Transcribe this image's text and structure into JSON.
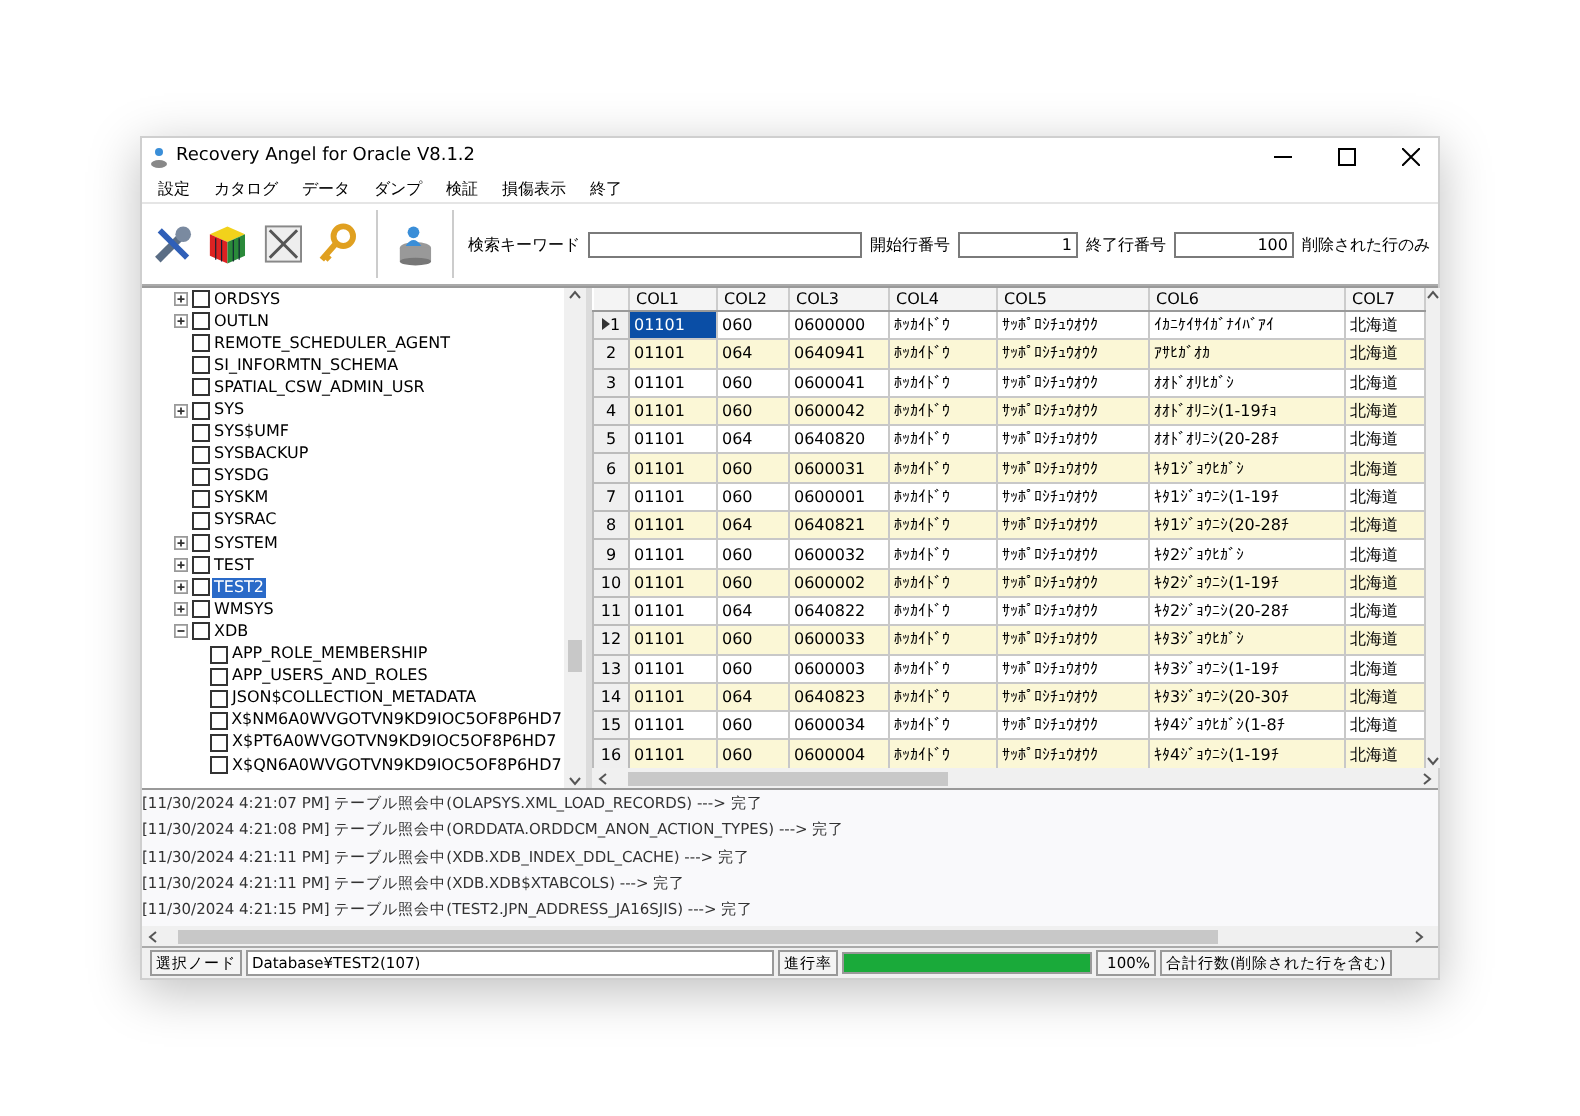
{
  "window": {
    "title": "Recovery Angel for Oracle V8.1.2"
  },
  "menu": [
    "設定",
    "カタログ",
    "データ",
    "ダンプ",
    "検証",
    "損傷表示",
    "終了"
  ],
  "toolbar": {
    "keyword_label": "検索キーワード",
    "start_label": "開始行番号",
    "start_value": "1",
    "end_label": "終了行番号",
    "end_value": "100",
    "deleted_only_label": "削除された行のみ"
  },
  "tree": [
    {
      "label": "ORDSYS",
      "kind": "collapsed",
      "checked": false,
      "selected": false
    },
    {
      "label": "OUTLN",
      "kind": "collapsed",
      "checked": false,
      "selected": false
    },
    {
      "label": "REMOTE_SCHEDULER_AGENT",
      "kind": "leaf",
      "checked": false,
      "selected": false
    },
    {
      "label": "SI_INFORMTN_SCHEMA",
      "kind": "leaf",
      "checked": false,
      "selected": false
    },
    {
      "label": "SPATIAL_CSW_ADMIN_USR",
      "kind": "leaf",
      "checked": false,
      "selected": false
    },
    {
      "label": "SYS",
      "kind": "collapsed",
      "checked": false,
      "selected": false
    },
    {
      "label": "SYS$UMF",
      "kind": "leaf",
      "checked": false,
      "selected": false
    },
    {
      "label": "SYSBACKUP",
      "kind": "leaf",
      "checked": false,
      "selected": false
    },
    {
      "label": "SYSDG",
      "kind": "leaf",
      "checked": false,
      "selected": false
    },
    {
      "label": "SYSKM",
      "kind": "leaf",
      "checked": false,
      "selected": false
    },
    {
      "label": "SYSRAC",
      "kind": "leaf",
      "checked": false,
      "selected": false
    },
    {
      "label": "SYSTEM",
      "kind": "collapsed",
      "checked": false,
      "selected": false
    },
    {
      "label": "TEST",
      "kind": "collapsed",
      "checked": false,
      "selected": false
    },
    {
      "label": "TEST2",
      "kind": "collapsed",
      "checked": false,
      "selected": true
    },
    {
      "label": "WMSYS",
      "kind": "collapsed",
      "checked": false,
      "selected": false
    },
    {
      "label": "XDB",
      "kind": "expanded",
      "checked": false,
      "selected": false,
      "children": [
        {
          "label": "APP_ROLE_MEMBERSHIP",
          "kind": "leaf",
          "checked": false,
          "selected": false
        },
        {
          "label": "APP_USERS_AND_ROLES",
          "kind": "leaf",
          "checked": false,
          "selected": false
        },
        {
          "label": "JSON$COLLECTION_METADATA",
          "kind": "leaf",
          "checked": false,
          "selected": false
        },
        {
          "label": "X$NM6A0WVGOTVN9KD9IOC5OF8P6HD7",
          "kind": "leaf",
          "checked": false,
          "selected": false
        },
        {
          "label": "X$PT6A0WVGOTVN9KD9IOC5OF8P6HD7",
          "kind": "leaf",
          "checked": false,
          "selected": false
        },
        {
          "label": "X$QN6A0WVGOTVN9KD9IOC5OF8P6HD7",
          "kind": "leaf",
          "checked": false,
          "selected": false
        }
      ]
    }
  ],
  "grid": {
    "columns": [
      {
        "label": "COL1",
        "selected": true
      },
      {
        "label": "COL2",
        "selected": false
      },
      {
        "label": "COL3",
        "selected": false
      },
      {
        "label": "COL4",
        "selected": false
      },
      {
        "label": "COL5",
        "selected": false
      },
      {
        "label": "COL6",
        "selected": false
      },
      {
        "label": "COL7",
        "selected": false
      }
    ],
    "rows": [
      {
        "number": "1",
        "current": true,
        "cells": [
          "01101",
          "060",
          "0600000",
          "ﾎｯｶｲﾄﾞｳ",
          "ｻｯﾎﾟﾛｼﾁｭｳｵｳｸ",
          "ｲｶﾆｹｲｻｲｶﾞﾅｲﾊﾞｱｲ",
          "北海道"
        ]
      },
      {
        "number": "2",
        "current": false,
        "cells": [
          "01101",
          "064",
          "0640941",
          "ﾎｯｶｲﾄﾞｳ",
          "ｻｯﾎﾟﾛｼﾁｭｳｵｳｸ",
          "ｱｻﾋｶﾞｵｶ",
          "北海道"
        ]
      },
      {
        "number": "3",
        "current": false,
        "cells": [
          "01101",
          "060",
          "0600041",
          "ﾎｯｶｲﾄﾞｳ",
          "ｻｯﾎﾟﾛｼﾁｭｳｵｳｸ",
          "ｵｵﾄﾞｵﾘﾋｶﾞｼ",
          "北海道"
        ]
      },
      {
        "number": "4",
        "current": false,
        "cells": [
          "01101",
          "060",
          "0600042",
          "ﾎｯｶｲﾄﾞｳ",
          "ｻｯﾎﾟﾛｼﾁｭｳｵｳｸ",
          "ｵｵﾄﾞｵﾘﾆｼ(1-19ﾁｮ",
          "北海道"
        ]
      },
      {
        "number": "5",
        "current": false,
        "cells": [
          "01101",
          "064",
          "0640820",
          "ﾎｯｶｲﾄﾞｳ",
          "ｻｯﾎﾟﾛｼﾁｭｳｵｳｸ",
          "ｵｵﾄﾞｵﾘﾆｼ(20-28ﾁ",
          "北海道"
        ]
      },
      {
        "number": "6",
        "current": false,
        "cells": [
          "01101",
          "060",
          "0600031",
          "ﾎｯｶｲﾄﾞｳ",
          "ｻｯﾎﾟﾛｼﾁｭｳｵｳｸ",
          "ｷﾀ1ｼﾞｮｳﾋｶﾞｼ",
          "北海道"
        ]
      },
      {
        "number": "7",
        "current": false,
        "cells": [
          "01101",
          "060",
          "0600001",
          "ﾎｯｶｲﾄﾞｳ",
          "ｻｯﾎﾟﾛｼﾁｭｳｵｳｸ",
          "ｷﾀ1ｼﾞｮｳﾆｼ(1-19ﾁ",
          "北海道"
        ]
      },
      {
        "number": "8",
        "current": false,
        "cells": [
          "01101",
          "064",
          "0640821",
          "ﾎｯｶｲﾄﾞｳ",
          "ｻｯﾎﾟﾛｼﾁｭｳｵｳｸ",
          "ｷﾀ1ｼﾞｮｳﾆｼ(20-28ﾁ",
          "北海道"
        ]
      },
      {
        "number": "9",
        "current": false,
        "cells": [
          "01101",
          "060",
          "0600032",
          "ﾎｯｶｲﾄﾞｳ",
          "ｻｯﾎﾟﾛｼﾁｭｳｵｳｸ",
          "ｷﾀ2ｼﾞｮｳﾋｶﾞｼ",
          "北海道"
        ]
      },
      {
        "number": "10",
        "current": false,
        "cells": [
          "01101",
          "060",
          "0600002",
          "ﾎｯｶｲﾄﾞｳ",
          "ｻｯﾎﾟﾛｼﾁｭｳｵｳｸ",
          "ｷﾀ2ｼﾞｮｳﾆｼ(1-19ﾁ",
          "北海道"
        ]
      },
      {
        "number": "11",
        "current": false,
        "cells": [
          "01101",
          "064",
          "0640822",
          "ﾎｯｶｲﾄﾞｳ",
          "ｻｯﾎﾟﾛｼﾁｭｳｵｳｸ",
          "ｷﾀ2ｼﾞｮｳﾆｼ(20-28ﾁ",
          "北海道"
        ]
      },
      {
        "number": "12",
        "current": false,
        "cells": [
          "01101",
          "060",
          "0600033",
          "ﾎｯｶｲﾄﾞｳ",
          "ｻｯﾎﾟﾛｼﾁｭｳｵｳｸ",
          "ｷﾀ3ｼﾞｮｳﾋｶﾞｼ",
          "北海道"
        ]
      },
      {
        "number": "13",
        "current": false,
        "cells": [
          "01101",
          "060",
          "0600003",
          "ﾎｯｶｲﾄﾞｳ",
          "ｻｯﾎﾟﾛｼﾁｭｳｵｳｸ",
          "ｷﾀ3ｼﾞｮｳﾆｼ(1-19ﾁ",
          "北海道"
        ]
      },
      {
        "number": "14",
        "current": false,
        "cells": [
          "01101",
          "064",
          "0640823",
          "ﾎｯｶｲﾄﾞｳ",
          "ｻｯﾎﾟﾛｼﾁｭｳｵｳｸ",
          "ｷﾀ3ｼﾞｮｳﾆｼ(20-30ﾁ",
          "北海道"
        ]
      },
      {
        "number": "15",
        "current": false,
        "cells": [
          "01101",
          "060",
          "0600034",
          "ﾎｯｶｲﾄﾞｳ",
          "ｻｯﾎﾟﾛｼﾁｭｳｵｳｸ",
          "ｷﾀ4ｼﾞｮｳﾋｶﾞｼ(1-8ﾁ",
          "北海道"
        ]
      },
      {
        "number": "16",
        "current": false,
        "cells": [
          "01101",
          "060",
          "0600004",
          "ﾎｯｶｲﾄﾞｳ",
          "ｻｯﾎﾟﾛｼﾁｭｳｵｳｸ",
          "ｷﾀ4ｼﾞｮｳﾆｼ(1-19ﾁ",
          "北海道"
        ]
      }
    ]
  },
  "log": [
    "[11/30/2024 4:21:07 PM] テーブル照会中(OLAPSYS.XML_LOAD_RECORDS) ---> 完了",
    "[11/30/2024 4:21:08 PM] テーブル照会中(ORDDATA.ORDDCM_ANON_ACTION_TYPES) ---> 完了",
    "[11/30/2024 4:21:11 PM] テーブル照会中(XDB.XDB_INDEX_DDL_CACHE) ---> 完了",
    "[11/30/2024 4:21:11 PM] テーブル照会中(XDB.XDB$XTABCOLS) ---> 完了",
    "[11/30/2024 4:21:15 PM] テーブル照会中(TEST2.JPN_ADDRESS_JA16SJIS) ---> 完了"
  ],
  "status_bar": {
    "node_label": "選択ノード",
    "node_value": "Database¥TEST2(107)",
    "progress_label": "進行率",
    "progress": {
      "level": 1.0
    },
    "percent": "100%",
    "total_label": "合計行数(削除された行を含む)"
  }
}
